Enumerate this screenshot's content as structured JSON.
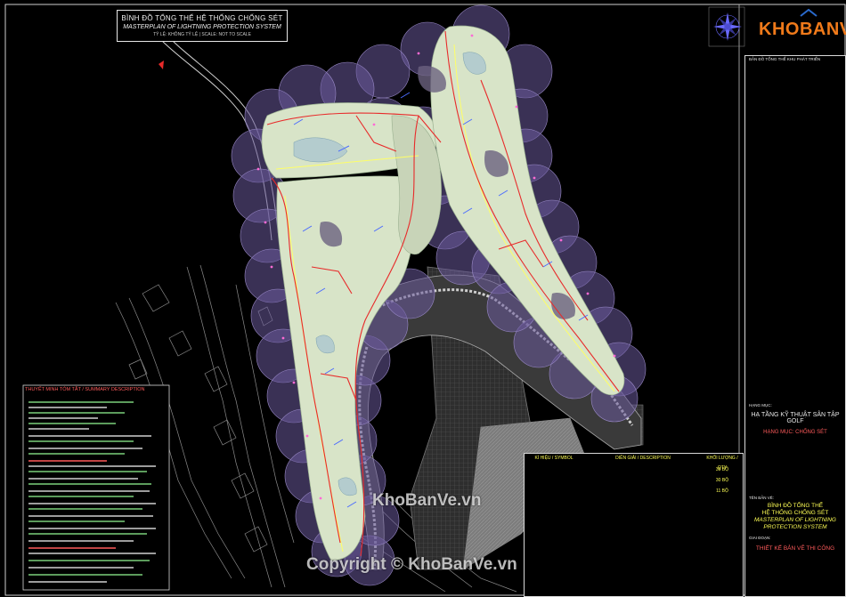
{
  "drawing_title": {
    "vn": "BÌNH ĐỒ TỔNG THỂ HỆ THỐNG CHỐNG SÉT",
    "en": "MASTERPLAN OF LIGHTNING PROTECTION SYSTEM",
    "scale": "TỶ LỆ: KHÔNG TỶ LỆ | SCALE: NOT TO SCALE"
  },
  "logo_text": "KHOBANVE",
  "side_panel": {
    "key_plan_caption": "BẢN ĐỒ TỔNG THỂ KHU PHÁT TRIỂN",
    "item_label": "HẠNG MỤC:",
    "project": "HẠ TẦNG KỸ THUẬT SÂN TẬP GOLF",
    "category": "HẠNG MỤC: CHỐNG SÉT",
    "drawing_label": "TÊN BẢN VẼ:",
    "drawing_name_vn_1": "BÌNH ĐỒ TỔNG THỂ",
    "drawing_name_vn_2": "HỆ THỐNG CHỐNG SÉT",
    "drawing_name_en_1": "MASTERPLAN OF LIGHTNING",
    "drawing_name_en_2": "PROTECTION SYSTEM",
    "stage_label": "GIAI ĐOẠN:",
    "stage": "THIẾT KẾ BẢN VẼ THI CÔNG"
  },
  "summary": {
    "title": "THUYẾT MINH TÓM TẮT / SUMMARY DESCRIPTION"
  },
  "legend": {
    "col_symbol": "KÍ HIỆU / SYMBOL",
    "col_description": "DIỄN GIẢI / DESCRIPTION",
    "col_quantity": "KHỐI LƯỢNG / QTY",
    "rows": [
      {
        "qty": "30 BỘ"
      },
      {
        "qty": "30 BỘ"
      },
      {
        "qty": "11 BỘ"
      }
    ]
  },
  "watermarks": {
    "site": "KhoBanVe.vn",
    "copyright": "Copyright © KhoBanVe.vn"
  },
  "colors": {
    "protection_zone": "#6a5a9a",
    "fairway": "#d8e4c8",
    "rough": "#8c8aa0",
    "cable": "#e82a2a",
    "path": "#ffff66",
    "accent_text": "#ff5b5b",
    "brand_orange": "#f07a1a"
  }
}
